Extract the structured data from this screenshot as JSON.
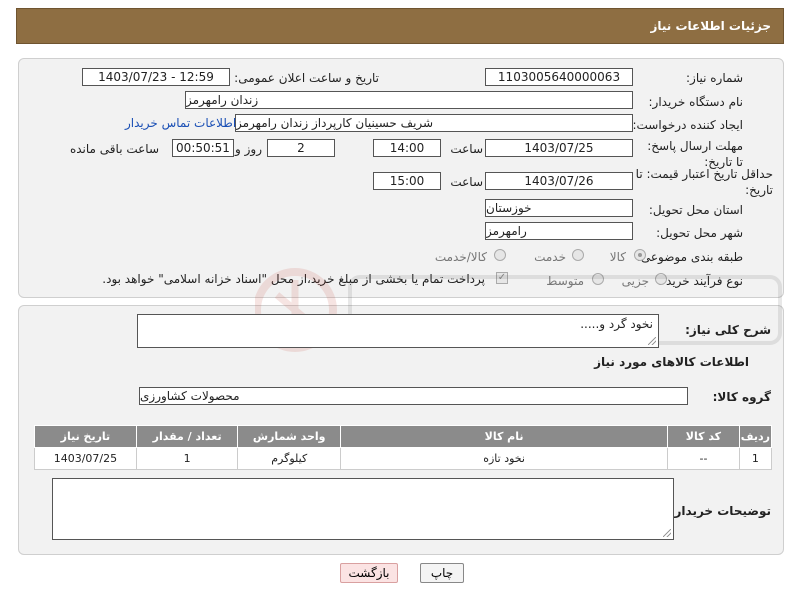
{
  "header": {
    "title": "جزئیات اطلاعات نیاز"
  },
  "form": {
    "need_number_label": "شماره نیاز:",
    "need_number": "1103005640000063",
    "announce_label": "تاریخ و ساعت اعلان عمومی:",
    "announce_value": "1403/07/23 - 12:59",
    "buyer_org_label": "نام دستگاه خریدار:",
    "buyer_org": "زندان رامهرمز",
    "creator_label": "ایجاد کننده درخواست:",
    "creator": "شریف حسینیان کارپرداز زندان رامهرمز",
    "contact_link": "اطلاعات تماس خریدار",
    "reply_deadline_label": "مهلت ارسال پاسخ: تا تاریخ:",
    "reply_date": "1403/07/25",
    "time_label": "ساعت",
    "reply_time": "14:00",
    "days_value": "2",
    "days_label": "روز و",
    "remaining_time": "00:50:51",
    "remaining_label": "ساعت باقی مانده",
    "price_validity_label": "حداقل تاریخ اعتبار قیمت: تا تاریخ:",
    "validity_date": "1403/07/26",
    "validity_time": "15:00",
    "province_label": "استان محل تحویل:",
    "province": "خوزستان",
    "city_label": "شهر محل تحویل:",
    "city": "رامهرمز",
    "category_label": "طبقه بندی موضوعی:",
    "category_options": [
      "کالا",
      "خدمت",
      "کالا/خدمت"
    ],
    "process_label": "نوع فرآیند خرید :",
    "process_options": [
      "جزیی",
      "متوسط"
    ],
    "payment_note": "پرداخت تمام یا بخشی از مبلغ خرید،از محل \"اسناد خزانه اسلامی\" خواهد بود."
  },
  "details": {
    "description_label": "شرح کلی نیاز:",
    "description": "نخود گرد و.....",
    "goods_info_title": "اطلاعات کالاهای مورد نیاز",
    "goods_group_label": "گروه کالا:",
    "goods_group": "محصولات کشاورزی"
  },
  "table": {
    "headers": [
      "ردیف",
      "کد کالا",
      "نام کالا",
      "واحد شمارش",
      "تعداد / مقدار",
      "تاریخ نیاز"
    ],
    "rows": [
      [
        "1",
        "--",
        "نخود تازه",
        "کیلوگرم",
        "1",
        "1403/07/25"
      ]
    ]
  },
  "buyer_notes_label": "توضیحات خریدار:",
  "buttons": {
    "print": "چاپ",
    "back": "بازگشت"
  },
  "colors": {
    "title_bar": "#8e6e42",
    "table_header": "#8b8b8b",
    "back_button": "#fbe3e3"
  }
}
